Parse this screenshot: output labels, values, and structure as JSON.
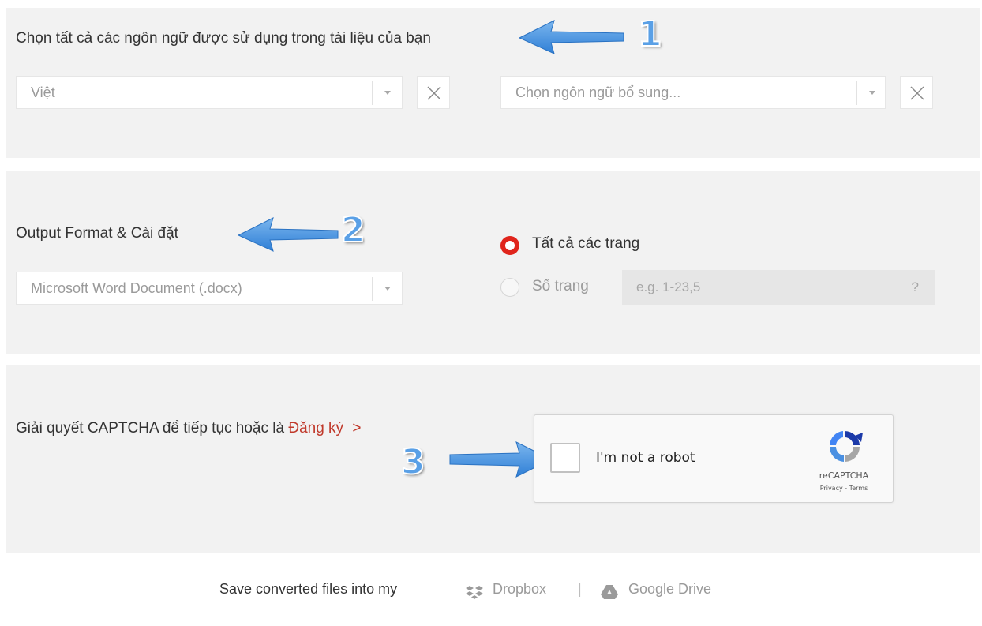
{
  "section_languages": {
    "heading": "Chọn tất cả các ngôn ngữ được sử dụng trong tài liệu của bạn",
    "annotation_number": "1",
    "primary_language": "Việt",
    "additional_language_placeholder": "Chọn ngôn ngữ bổ sung..."
  },
  "section_output": {
    "heading": "Output Format & Cài đặt",
    "annotation_number": "2",
    "format_value": "Microsoft Word Document (.docx)",
    "radio_all_pages": "Tất cả các trang",
    "radio_page_numbers": "Số trang",
    "page_numbers_placeholder": "e.g. 1-23,5",
    "help_symbol": "?"
  },
  "section_captcha": {
    "heading_prefix": "Giải quyết CAPTCHA để tiếp tục hoặc là ",
    "signup_link": "Đăng ký",
    "chevron": ">",
    "annotation_number": "3",
    "checkbox_label": "I'm not a robot",
    "brand": "reCAPTCHA",
    "terms": "Privacy - Terms"
  },
  "footer": {
    "save_text": "Save converted files into my",
    "dropbox_label": "Dropbox",
    "divider": "|",
    "gdrive_label": "Google Drive"
  },
  "colors": {
    "panel_bg": "#f2f2f2",
    "accent_red": "#e0251c",
    "link_red": "#c0392b",
    "annotation_blue": "#5aa0e6"
  }
}
